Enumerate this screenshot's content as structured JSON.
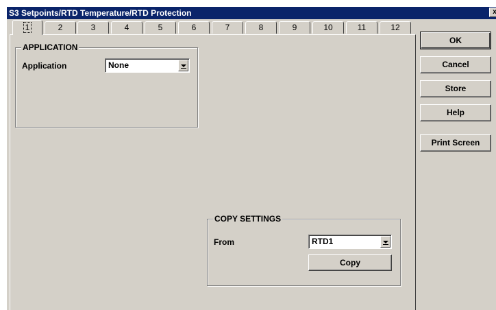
{
  "window": {
    "title": "S3 Setpoints/RTD Temperature/RTD Protection",
    "close_glyph": "x"
  },
  "tabs": [
    "1",
    "2",
    "3",
    "4",
    "5",
    "6",
    "7",
    "8",
    "9",
    "10",
    "11",
    "12"
  ],
  "active_tab": "1",
  "application_group": {
    "legend": "APPLICATION",
    "application_label": "Application",
    "application_value": "None"
  },
  "copy_group": {
    "legend": "COPY SETTINGS",
    "from_label": "From",
    "from_value": "RTD1",
    "copy_label": "Copy"
  },
  "side_buttons": {
    "ok": "OK",
    "cancel": "Cancel",
    "store": "Store",
    "help": "Help",
    "print_screen": "Print Screen"
  },
  "icons": {
    "dropdown": "chevron-down-icon",
    "close": "close-icon"
  }
}
